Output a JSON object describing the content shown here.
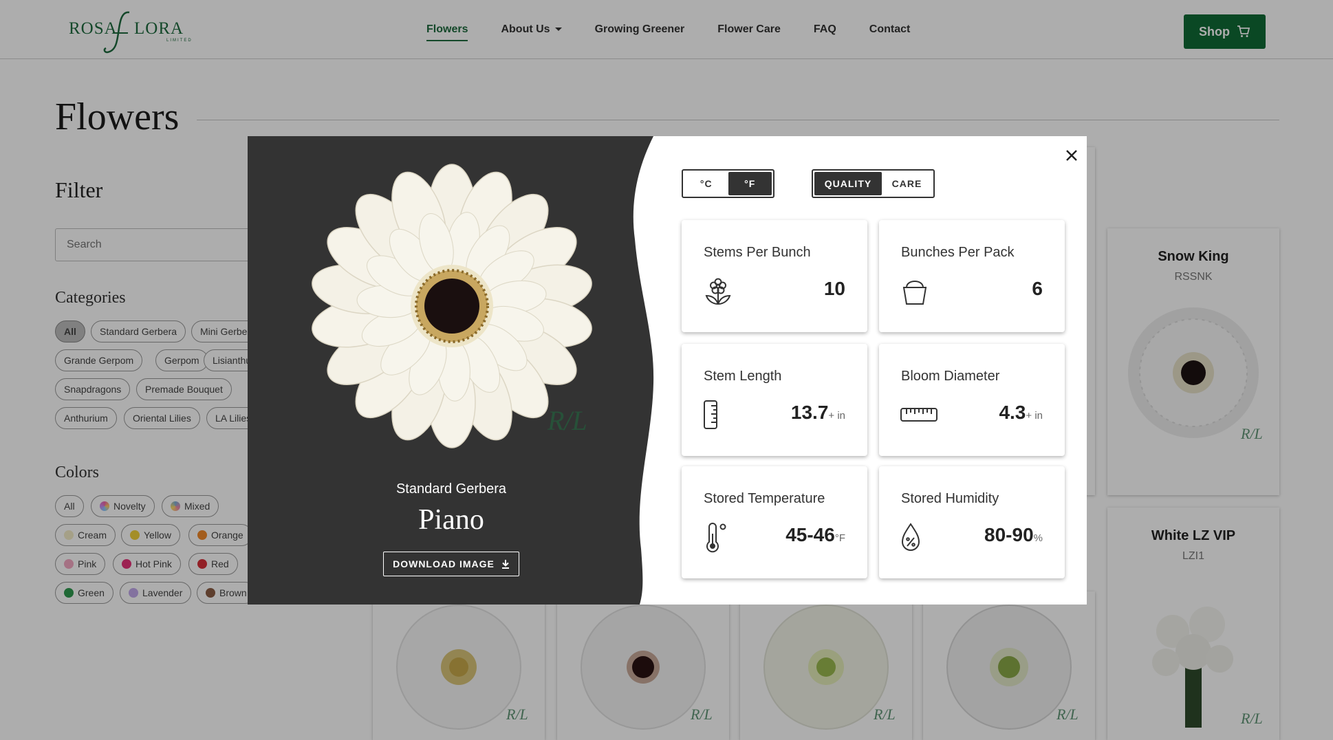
{
  "header": {
    "logo_left": "ROSA",
    "logo_right": "LORA",
    "logo_sub": "LIMITED",
    "nav": [
      {
        "label": "Flowers"
      },
      {
        "label": "About Us"
      },
      {
        "label": "Growing Greener"
      },
      {
        "label": "Flower Care"
      },
      {
        "label": "FAQ"
      },
      {
        "label": "Contact"
      }
    ],
    "shop_label": "Shop"
  },
  "page": {
    "title": "Flowers",
    "filter_title": "Filter",
    "search_placeholder": "Search",
    "categories_title": "Categories",
    "categories": [
      "All",
      "Standard Gerbera",
      "Mini Gerbera",
      "Grande Gerpom",
      "Gerpom",
      "Lisianthus",
      "Snapdragons",
      "Premade Bouquet",
      "Anthurium",
      "Oriental Lilies",
      "LA Lilies"
    ],
    "colors_title": "Colors",
    "colors": [
      {
        "label": "All",
        "color": ""
      },
      {
        "label": "Novelty",
        "color": "#c78ad6"
      },
      {
        "label": "Mixed",
        "color": "#7fb0d8"
      },
      {
        "label": "Cream",
        "color": "#f3ecc7"
      },
      {
        "label": "Yellow",
        "color": "#f2d13c"
      },
      {
        "label": "Orange",
        "color": "#f08a2c"
      },
      {
        "label": "Pink",
        "color": "#f4a9c3"
      },
      {
        "label": "Hot Pink",
        "color": "#e6337a"
      },
      {
        "label": "Red",
        "color": "#d8313a"
      },
      {
        "label": "Green",
        "color": "#2e9a4f"
      },
      {
        "label": "Lavender",
        "color": "#c2a9ea"
      },
      {
        "label": "Brown",
        "color": "#8b5e45"
      }
    ]
  },
  "cards": [
    {
      "title": "Snow King",
      "code": "RSSNK"
    },
    {
      "title": "White LZ VIP",
      "code": "LZI1"
    }
  ],
  "watermark": "R/L",
  "modal": {
    "unit_c": "°C",
    "unit_f": "°F",
    "tab_quality": "QUALITY",
    "tab_care": "CARE",
    "category": "Standard Gerbera",
    "name": "Piano",
    "download_label": "DOWNLOAD IMAGE",
    "stats": [
      {
        "label": "Stems Per Bunch",
        "value": "10",
        "unit": "",
        "icon": "flower-icon"
      },
      {
        "label": "Bunches Per Pack",
        "value": "6",
        "unit": "",
        "icon": "bucket-icon"
      },
      {
        "label": "Stem Length",
        "value": "13.7",
        "unit": "+ in",
        "icon": "ruler-vertical-icon"
      },
      {
        "label": "Bloom Diameter",
        "value": "4.3",
        "unit": "+ in",
        "icon": "ruler-horizontal-icon"
      },
      {
        "label": "Stored Temperature",
        "value": "45-46",
        "unit": "°F",
        "icon": "thermometer-icon"
      },
      {
        "label": "Stored Humidity",
        "value": "80-90",
        "unit": "%",
        "icon": "humidity-icon"
      }
    ]
  }
}
